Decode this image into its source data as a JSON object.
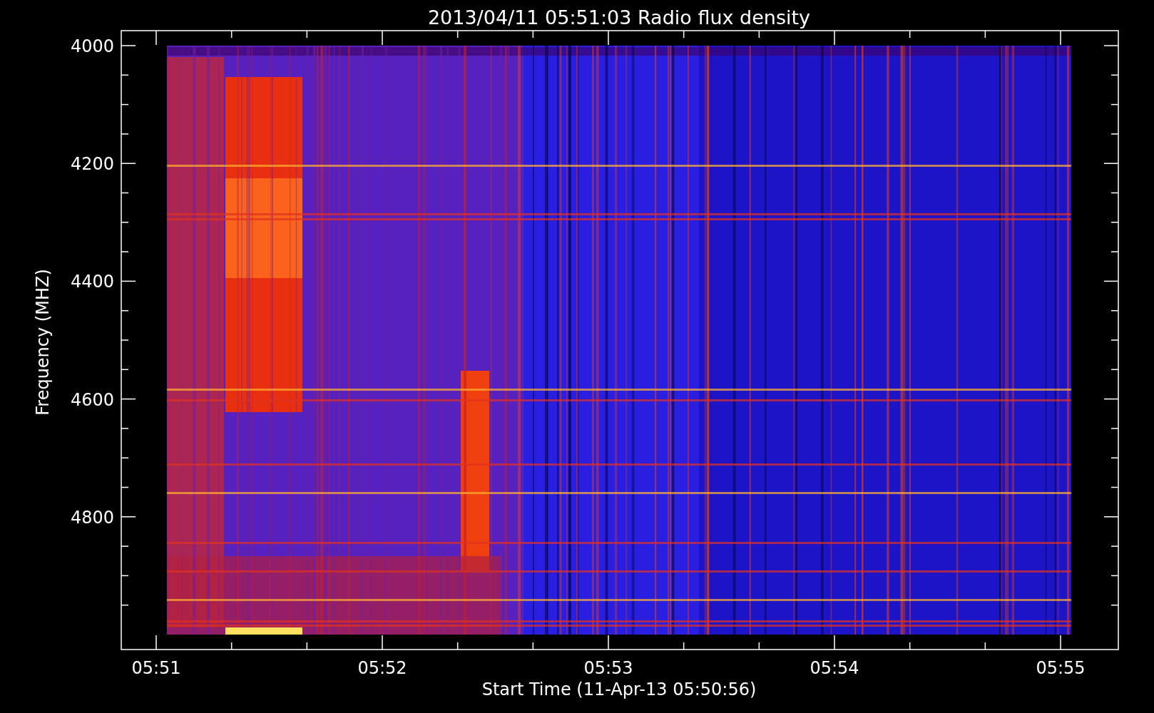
{
  "title": "2013/04/11 05:51:03 Radio flux density",
  "y_axis": {
    "label": "Frequency (MHZ)",
    "ticks": [
      "4000",
      "4200",
      "4400",
      "4600",
      "4800"
    ]
  },
  "x_axis": {
    "label": "Start Time (11-Apr-13 05:50:56)",
    "ticks": [
      "05:51",
      "05:52",
      "05:53",
      "05:54",
      "05:55"
    ]
  }
}
